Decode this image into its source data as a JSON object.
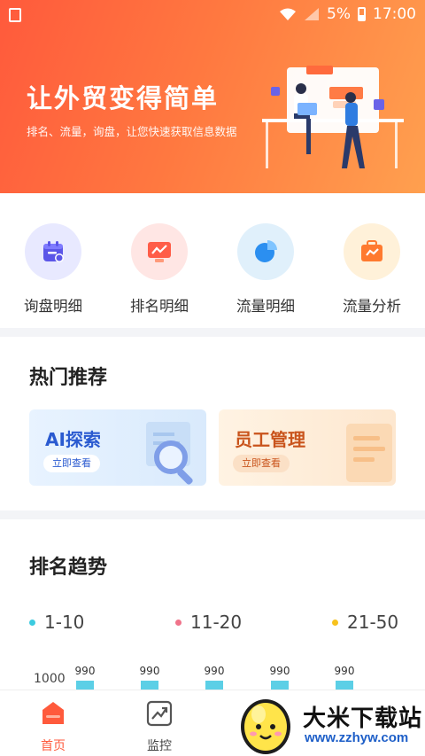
{
  "status_bar": {
    "battery": "5%",
    "time": "17:00"
  },
  "hero": {
    "title": "让外贸变得简单",
    "subtitle": "排名、流量，询盘，让您快速获取信息数据"
  },
  "quick_actions": [
    {
      "label": "询盘明细",
      "icon": "calendar-icon",
      "bg": "#e8e9ff",
      "color": "#5b56e8"
    },
    {
      "label": "排名明细",
      "icon": "monitor-chart-icon",
      "bg": "#ffe6e4",
      "color": "#ff5d48"
    },
    {
      "label": "流量明细",
      "icon": "pie-chart-icon",
      "bg": "#e0f0fb",
      "color": "#2b8ff0"
    },
    {
      "label": "流量分析",
      "icon": "briefcase-chart-icon",
      "bg": "#fff1d9",
      "color": "#ff7a2f"
    }
  ],
  "hot": {
    "title": "热门推荐",
    "cards": [
      {
        "title": "AI探索",
        "button": "立即查看",
        "icon": "magnifier-icon"
      },
      {
        "title": "员工管理",
        "button": "立即查看",
        "icon": "document-icon"
      }
    ]
  },
  "trend": {
    "title": "排名趋势",
    "legend": [
      {
        "label": "1-10",
        "color": "#3ccbe0"
      },
      {
        "label": "11-20",
        "color": "#f0738a"
      },
      {
        "label": "21-50",
        "color": "#f7c21d"
      }
    ],
    "y_tick": "1000",
    "bar_labels": [
      "990",
      "990",
      "990",
      "990",
      "990"
    ]
  },
  "bottom_nav": [
    {
      "label": "首页",
      "icon": "home-icon",
      "active": true
    },
    {
      "label": "监控",
      "icon": "monitor-trend-icon",
      "active": false
    }
  ],
  "watermark": {
    "title": "大米下载站",
    "url": "www.zzhyw.com"
  }
}
